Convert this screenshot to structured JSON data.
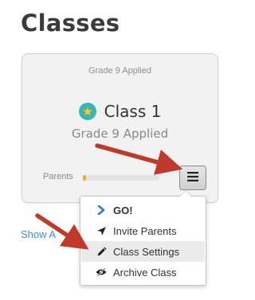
{
  "page": {
    "title": "Classes",
    "show_all_label": "Show A"
  },
  "class_card": {
    "subtitle": "Grade 9 Applied",
    "class_name": "Class 1",
    "class_grade": "Grade 9 Applied",
    "parents_label": "Parents",
    "parents_progress": 0.04,
    "badge_icon": "star-icon",
    "badge_color": "#35b6bb",
    "progress_color": "#f0a53a"
  },
  "menu": {
    "toggle_icon": "hamburger-icon",
    "items": [
      {
        "label": "GO!",
        "icon": "chevron-right-icon"
      },
      {
        "label": "Invite Parents",
        "icon": "paper-plane-icon"
      },
      {
        "label": "Class Settings",
        "icon": "pencil-icon"
      },
      {
        "label": "Archive Class",
        "icon": "archive-eye-icon"
      }
    ]
  },
  "annotation": {
    "arrow_color": "#c0392b"
  }
}
